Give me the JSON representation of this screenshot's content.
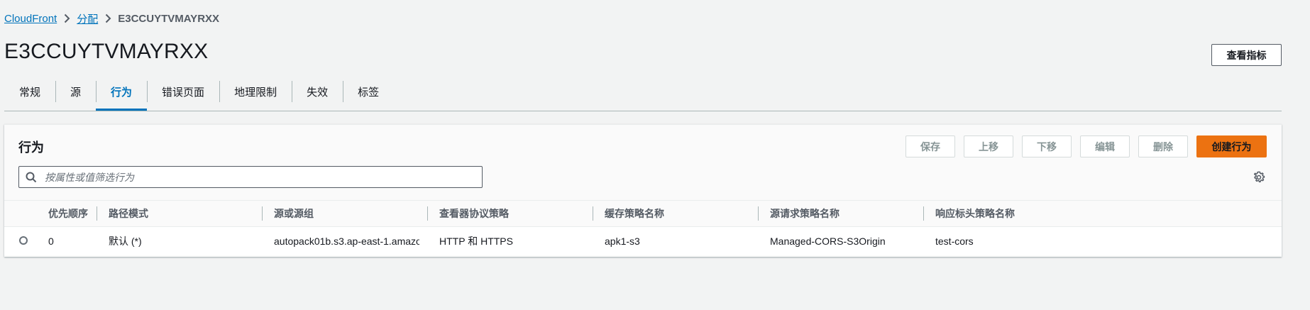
{
  "breadcrumb": {
    "items": [
      "CloudFront",
      "分配"
    ],
    "current": "E3CCUYTVMAYRXX"
  },
  "page": {
    "title": "E3CCUYTVMAYRXX",
    "metrics_button": "查看指标"
  },
  "tabs": [
    {
      "label": "常规"
    },
    {
      "label": "源"
    },
    {
      "label": "行为",
      "active": true
    },
    {
      "label": "错误页面"
    },
    {
      "label": "地理限制"
    },
    {
      "label": "失效"
    },
    {
      "label": "标签"
    }
  ],
  "behaviors": {
    "title": "行为",
    "buttons": {
      "save": "保存",
      "move_up": "上移",
      "move_down": "下移",
      "edit": "编辑",
      "delete": "删除",
      "create": "创建行为"
    },
    "search_placeholder": "按属性或值筛选行为",
    "columns": [
      "优先顺序",
      "路径模式",
      "源或源组",
      "查看器协议策略",
      "缓存策略名称",
      "源请求策略名称",
      "响应标头策略名称"
    ],
    "rows": [
      {
        "priority": "0",
        "path": "默认 (*)",
        "origin": "autopack01b.s3.ap-east-1.amazon…",
        "viewer_protocol": "HTTP 和 HTTPS",
        "cache_policy": "apk1-s3",
        "origin_request_policy": "Managed-CORS-S3Origin",
        "response_headers_policy": "test-cors"
      }
    ]
  },
  "colors": {
    "link": "#0073bb",
    "primary": "#ec7211",
    "background": "#f2f3f3"
  },
  "icons": [
    "chevron-right-icon",
    "search-icon",
    "settings-gear-icon",
    "radio-icon"
  ]
}
